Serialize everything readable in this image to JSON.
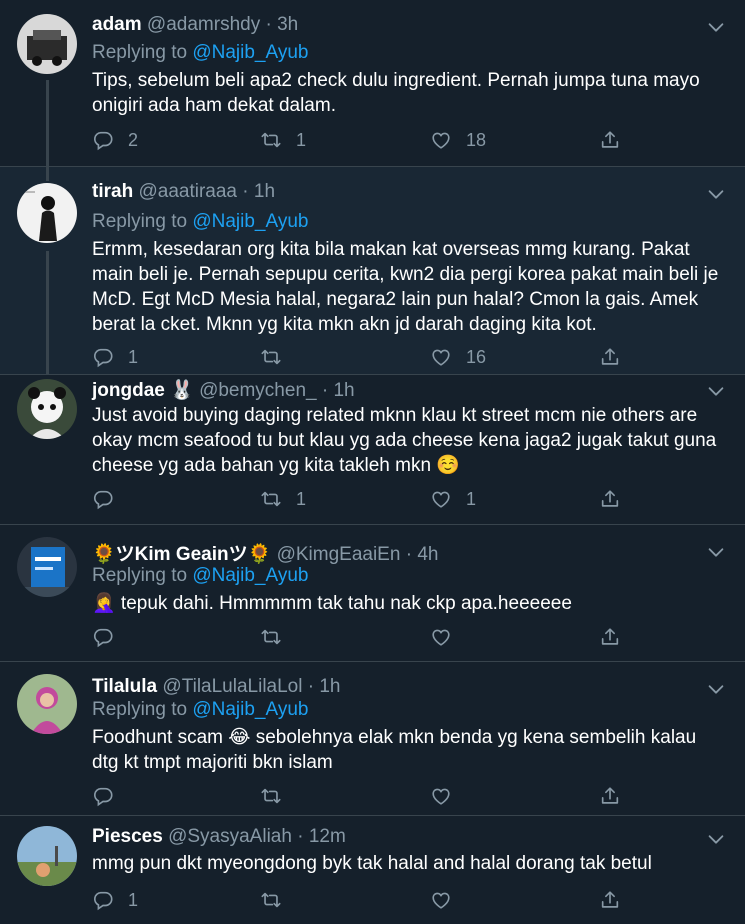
{
  "tweets": [
    {
      "name": "adam",
      "handle": "@adamrshdy",
      "time": "3h",
      "replying_label": "Replying to",
      "replying_to": "@Najib_Ayub",
      "text": "Tips, sebelum beli apa2 check dulu ingredient. Pernah jumpa tuna mayo onigiri ada ham dekat dalam.",
      "replies": "2",
      "retweets": "1",
      "likes": "18"
    },
    {
      "name": "tirah",
      "handle": "@aaatiraaa",
      "time": "1h",
      "replying_label": "Replying to",
      "replying_to": "@Najib_Ayub",
      "text": "Ermm, kesedaran org kita bila makan kat overseas mmg kurang. Pakat main beli je. Pernah sepupu cerita, kwn2 dia pergi korea pakat main beli je McD. Egt McD Mesia halal, negara2 lain pun halal? Cmon la gais. Amek berat la cket. Mknn yg kita mkn akn jd darah daging kita kot.",
      "replies": "1",
      "retweets": "",
      "likes": "16"
    },
    {
      "name": "jongdae 🐰",
      "handle": "@bemychen_",
      "time": "1h",
      "text": "Just avoid buying daging related mknn klau kt street mcm nie others are okay mcm seafood tu but klau yg ada cheese kena jaga2 jugak takut guna cheese yg ada bahan yg kita takleh mkn ☺️",
      "replies": "",
      "retweets": "1",
      "likes": "1"
    },
    {
      "name": "🌻ツKim Geainツ🌻",
      "handle": "@KimgEaaiEn",
      "time": "4h",
      "replying_label": "Replying to",
      "replying_to": "@Najib_Ayub",
      "text": "🤦‍♀️ tepuk dahi. Hmmmmm tak tahu nak ckp apa.heeeeee",
      "replies": "",
      "retweets": "",
      "likes": ""
    },
    {
      "name": "Tilalula",
      "handle": "@TilaLulaLilaLol",
      "time": "1h",
      "replying_label": "Replying to",
      "replying_to": "@Najib_Ayub",
      "text": "Foodhunt scam 😂 sebolehnya elak mkn benda yg kena sembelih kalau dtg kt tmpt majoriti bkn islam",
      "replies": "",
      "retweets": "",
      "likes": ""
    },
    {
      "name": "Piesces",
      "handle": "@SyasyaAliah",
      "time": "12m",
      "text": "mmg pun dkt myeongdong byk tak halal and halal dorang tak betul",
      "replies": "1",
      "retweets": "",
      "likes": ""
    }
  ],
  "separator": "·",
  "colors": {
    "background": "#15202b",
    "highlight_background": "#192734",
    "text": "#ffffff",
    "muted": "#8899a6",
    "link": "#1da1f2",
    "border": "#38444d"
  },
  "icons": {
    "reply": "reply-icon",
    "retweet": "retweet-icon",
    "like": "like-icon",
    "share": "share-icon",
    "menu": "chevron-down-icon"
  }
}
